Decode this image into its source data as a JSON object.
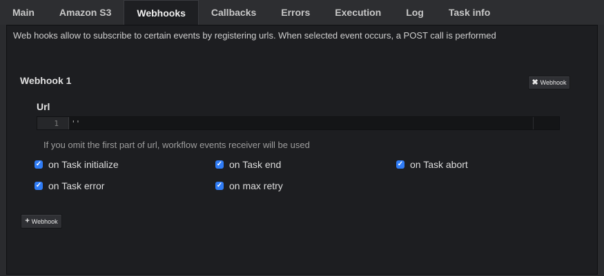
{
  "tabs": [
    {
      "label": "Main"
    },
    {
      "label": "Amazon S3"
    },
    {
      "label": "Webhooks"
    },
    {
      "label": "Callbacks"
    },
    {
      "label": "Errors"
    },
    {
      "label": "Execution"
    },
    {
      "label": "Log"
    },
    {
      "label": "Task info"
    }
  ],
  "active_tab": "Webhooks",
  "description": "Web hooks allow to subscribe to certain events by registering urls. When selected event occurs, a POST call is performed",
  "webhook": {
    "title": "Webhook 1",
    "remove_button_label": "Webhook",
    "url_label": "Url",
    "editor": {
      "line_number": "1",
      "value": "''"
    },
    "hint": "If you omit the first part of url, workflow events receiver will be used",
    "events": [
      {
        "label": "on Task initialize",
        "checked": true
      },
      {
        "label": "on Task end",
        "checked": true
      },
      {
        "label": "on Task abort",
        "checked": true
      },
      {
        "label": "on Task error",
        "checked": true
      },
      {
        "label": "on max retry",
        "checked": true
      }
    ]
  },
  "add_button_label": "Webhook",
  "colors": {
    "checkbox": "#2f7cf6",
    "panel": "#1d1e21",
    "tabbar": "#2d2e31"
  }
}
